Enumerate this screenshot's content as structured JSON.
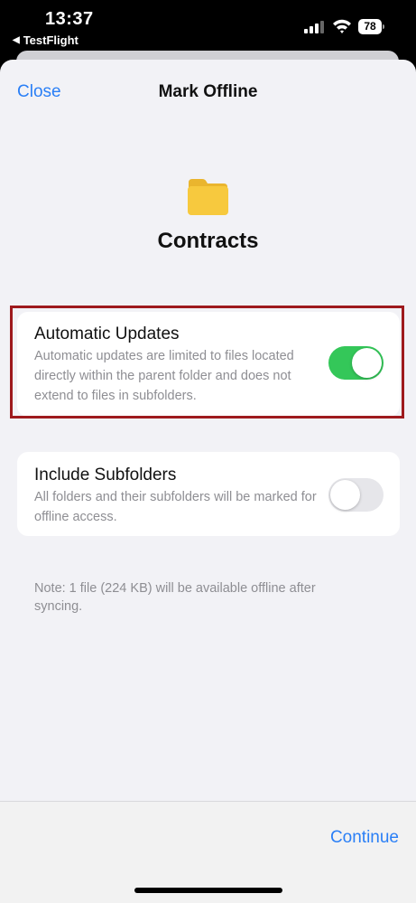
{
  "status_bar": {
    "time": "13:37",
    "back_app": "TestFlight",
    "battery": "78"
  },
  "header": {
    "close_label": "Close",
    "title": "Mark Offline"
  },
  "folder": {
    "name": "Contracts",
    "icon": "folder-icon",
    "color": "#f7c93e"
  },
  "automatic_updates": {
    "title": "Automatic Updates",
    "description": "Automatic updates are limited to files located directly within the parent folder and does not extend to files in subfolders.",
    "enabled": true
  },
  "include_subfolders": {
    "title": "Include Subfolders",
    "description": "All folders and their subfolders will be marked for offline access.",
    "enabled": false
  },
  "note": "Note: 1 file (224 KB) will be available offline after syncing.",
  "footer": {
    "continue_label": "Continue"
  },
  "colors": {
    "accent": "#2a7ff6",
    "toggle_on": "#34c759",
    "highlight": "#9e1a1d"
  }
}
